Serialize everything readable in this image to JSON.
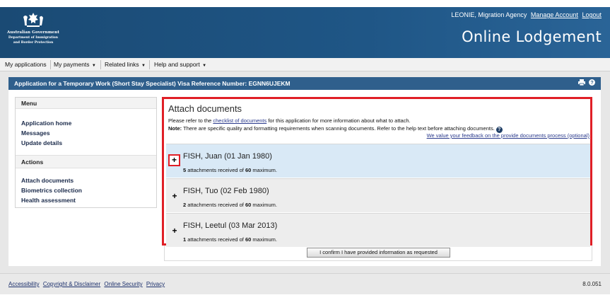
{
  "header": {
    "gov_name": "Australian Government",
    "dept_line1": "Department of Immigration",
    "dept_line2": "and Border Protection",
    "user_text": "LEONIE, Migration Agency",
    "manage_account": "Manage Account",
    "logout": "Logout",
    "app_title": "Online Lodgement"
  },
  "nav": {
    "items": [
      {
        "label": "My applications",
        "caret": ""
      },
      {
        "label": "My payments",
        "caret": "▼"
      },
      {
        "label": "Related links",
        "caret": "▼"
      },
      {
        "label": "Help and support",
        "caret": "▼"
      }
    ]
  },
  "app_bar": {
    "title": "Application for a Temporary Work (Short Stay Specialist) Visa Reference Number: EGNN6UJEKM",
    "print_icon": "print-icon",
    "help_icon": "help-icon"
  },
  "sidebar": {
    "menu_title": "Menu",
    "menu_items": [
      "Application home",
      "Messages",
      "Update details"
    ],
    "actions_title": "Actions",
    "action_items": [
      "Attach documents",
      "Biometrics collection",
      "Health assessment"
    ]
  },
  "attach": {
    "title": "Attach documents",
    "intro_prefix": "Please refer to the ",
    "checklist_link": "checklist of documents",
    "intro_suffix": " for this application for more information about what to attach.",
    "note_label": "Note:",
    "note_text": " There are specific quality and formatting requirements when scanning documents. Refer to the help text before attaching documents.",
    "feedback_link": "We value your feedback on the provide documents process (optional)",
    "applicants": [
      {
        "name": "FISH, Juan (01 Jan 1980)",
        "count": "5",
        "max": "60"
      },
      {
        "name": "FISH, Tuo (02 Feb 1980)",
        "count": "2",
        "max": "60"
      },
      {
        "name": "FISH, Leetul (03 Mar 2013)",
        "count": "1",
        "max": "60"
      }
    ],
    "att_mid": " attachments received of ",
    "att_end": " maximum.",
    "toggle_symbol": "+",
    "confirm_button": "I confirm I have provided information as requested"
  },
  "footer": {
    "links": [
      "Accessibility",
      "Copyright & Disclaimer",
      "Online Security",
      "Privacy"
    ],
    "version": "8.0.051"
  },
  "colors": {
    "header_blue": "#1f5686",
    "app_bar_blue": "#2f5f8c",
    "highlight_red": "#e01f26",
    "expanded_row": "#d9e9f6"
  }
}
